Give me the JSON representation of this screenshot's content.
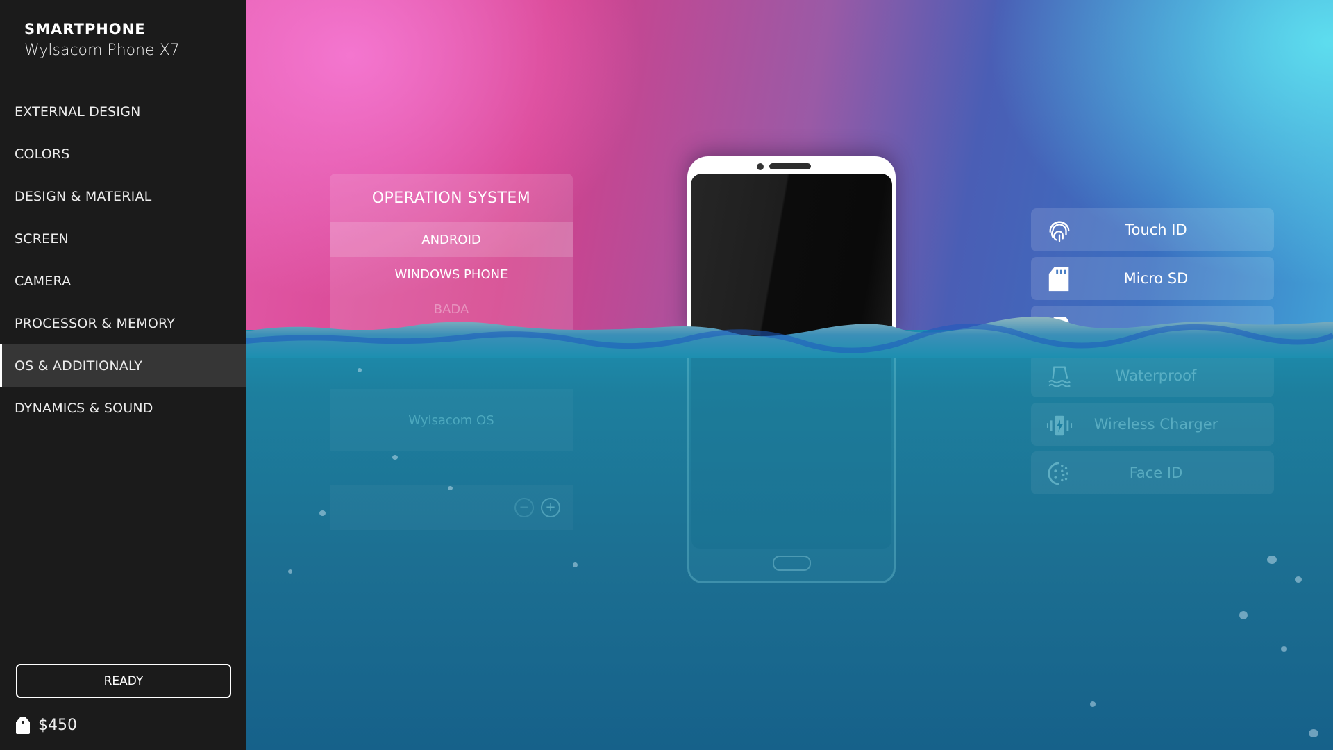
{
  "sidebar": {
    "kicker": "SMARTPHONE",
    "model_name": "Wylsacom Phone X7",
    "nav_items": [
      {
        "label": "EXTERNAL DESIGN",
        "active": false
      },
      {
        "label": "COLORS",
        "active": false
      },
      {
        "label": "DESIGN & MATERIAL",
        "active": false
      },
      {
        "label": "SCREEN",
        "active": false
      },
      {
        "label": "CAMERA",
        "active": false
      },
      {
        "label": "PROCESSOR & MEMORY",
        "active": false
      },
      {
        "label": "OS & ADDITIONALY",
        "active": true
      },
      {
        "label": "DYNAMICS & SOUND",
        "active": false
      }
    ],
    "ready_label": "READY",
    "price": "$450",
    "price_icon": "price-tag-icon"
  },
  "os_panel": {
    "title": "OPERATION SYSTEM",
    "options": [
      {
        "label": "ANDROID",
        "selected": true
      },
      {
        "label": "WINDOWS PHONE",
        "selected": false
      },
      {
        "label": "BADA",
        "selected": false,
        "disabled": true
      }
    ],
    "submerged_option": "Wylsacom OS",
    "stepper": {
      "minus_icon": "minus-icon",
      "plus_icon": "plus-icon"
    }
  },
  "features": [
    {
      "label": "Touch ID",
      "icon": "fingerprint-icon",
      "submerged": false
    },
    {
      "label": "Micro SD",
      "icon": "sd-card-icon",
      "submerged": false
    },
    {
      "label": "",
      "icon": "sim-card-icon",
      "submerged": true
    },
    {
      "label": "Waterproof",
      "icon": "waterproof-icon",
      "submerged": true
    },
    {
      "label": "Wireless Charger",
      "icon": "wireless-charger-icon",
      "submerged": true
    },
    {
      "label": "Face ID",
      "icon": "face-id-icon",
      "submerged": true
    }
  ],
  "colors": {
    "sidebar_bg": "#1b1b1b",
    "active_item_bg": "#363636",
    "pink": "#d43f8a",
    "cyan": "#5fe1f0",
    "water": "#1c6f92"
  }
}
